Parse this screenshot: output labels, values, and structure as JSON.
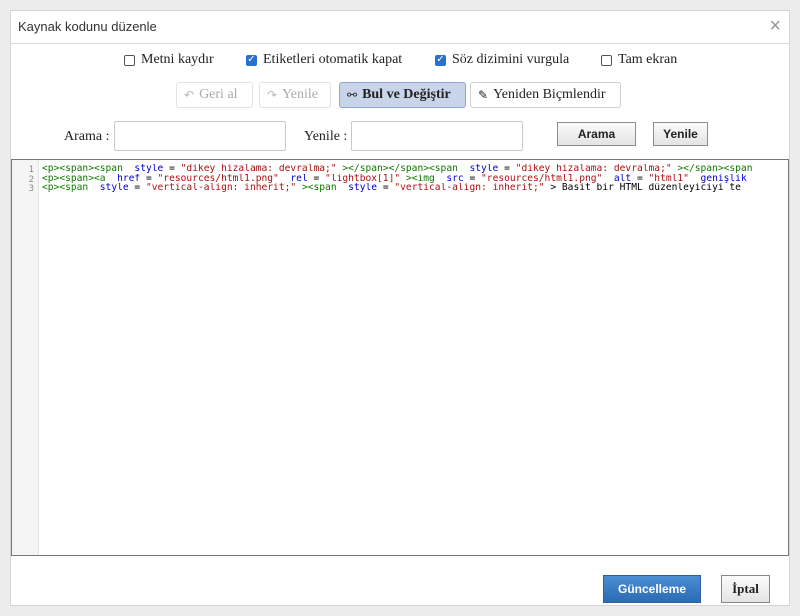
{
  "dialog": {
    "title": "Kaynak kodunu düzenle",
    "close_glyph": "×"
  },
  "options": [
    {
      "label": "Metni kaydır",
      "checked": false
    },
    {
      "label": "Etiketleri otomatik kapat",
      "checked": true
    },
    {
      "label": "Söz dizimini vurgula",
      "checked": true
    },
    {
      "label": "Tam ekran",
      "checked": false
    }
  ],
  "toolbar": {
    "undo_label": "Geri al",
    "undo_icon": "undo-icon",
    "redo_label": "Yenile",
    "redo_icon": "redo-icon",
    "find_replace_label": "Bul ve Değiştir",
    "find_replace_icon": "binoculars-icon",
    "reformat_label": "Yeniden Biçmlendir",
    "reformat_icon": "edit-icon"
  },
  "search": {
    "find_label": "Arama :",
    "find_value": "",
    "replace_label": "Yenile :",
    "replace_value": "",
    "find_button": "Arama",
    "replace_button": "Yenile"
  },
  "editor": {
    "line_numbers": [
      "1",
      "2",
      "3"
    ],
    "lines": [
      [
        {
          "t": "tag",
          "v": "<p><span><span  "
        },
        {
          "t": "att",
          "v": "style"
        },
        {
          "t": "txt",
          "v": " = "
        },
        {
          "t": "str",
          "v": "\"dikey hizalama: devralma;\""
        },
        {
          "t": "tag",
          "v": " ></span></span><span  "
        },
        {
          "t": "att",
          "v": "style"
        },
        {
          "t": "txt",
          "v": " = "
        },
        {
          "t": "str",
          "v": "\"dikey hizalama: devralma;\""
        },
        {
          "t": "tag",
          "v": " ></span><span"
        }
      ],
      [
        {
          "t": "tag",
          "v": "<p><span><a  "
        },
        {
          "t": "att",
          "v": "href"
        },
        {
          "t": "txt",
          "v": " = "
        },
        {
          "t": "str",
          "v": "\"resources/html1.png\""
        },
        {
          "t": "txt",
          "v": "  "
        },
        {
          "t": "att",
          "v": "rel"
        },
        {
          "t": "txt",
          "v": " = "
        },
        {
          "t": "str",
          "v": "\"lightbox[1]\""
        },
        {
          "t": "tag",
          "v": " ><img  "
        },
        {
          "t": "att",
          "v": "src"
        },
        {
          "t": "txt",
          "v": " = "
        },
        {
          "t": "str",
          "v": "\"resources/html1.png\""
        },
        {
          "t": "txt",
          "v": "  "
        },
        {
          "t": "att",
          "v": "alt"
        },
        {
          "t": "txt",
          "v": " = "
        },
        {
          "t": "str",
          "v": "\"html1\""
        },
        {
          "t": "txt",
          "v": "  "
        },
        {
          "t": "att",
          "v": "genişlik"
        }
      ],
      [
        {
          "t": "tag",
          "v": "<p><span  "
        },
        {
          "t": "att",
          "v": "style"
        },
        {
          "t": "txt",
          "v": " = "
        },
        {
          "t": "str",
          "v": "\"vertical-align: inherit;\""
        },
        {
          "t": "tag",
          "v": " ><span  "
        },
        {
          "t": "att",
          "v": "style"
        },
        {
          "t": "txt",
          "v": " = "
        },
        {
          "t": "str",
          "v": "\"vertical-align: inherit;\""
        },
        {
          "t": "txt",
          "v": " > Basit bir HTML düzenleyiciyi te"
        }
      ]
    ]
  },
  "footer": {
    "update_label": "Güncelleme",
    "cancel_label": "İptal"
  },
  "colors": {
    "accent": "#2a6fd1",
    "primary_button": "#3a7cc4",
    "tag": "#117700",
    "attr": "#0000cc",
    "string": "#aa1111"
  }
}
